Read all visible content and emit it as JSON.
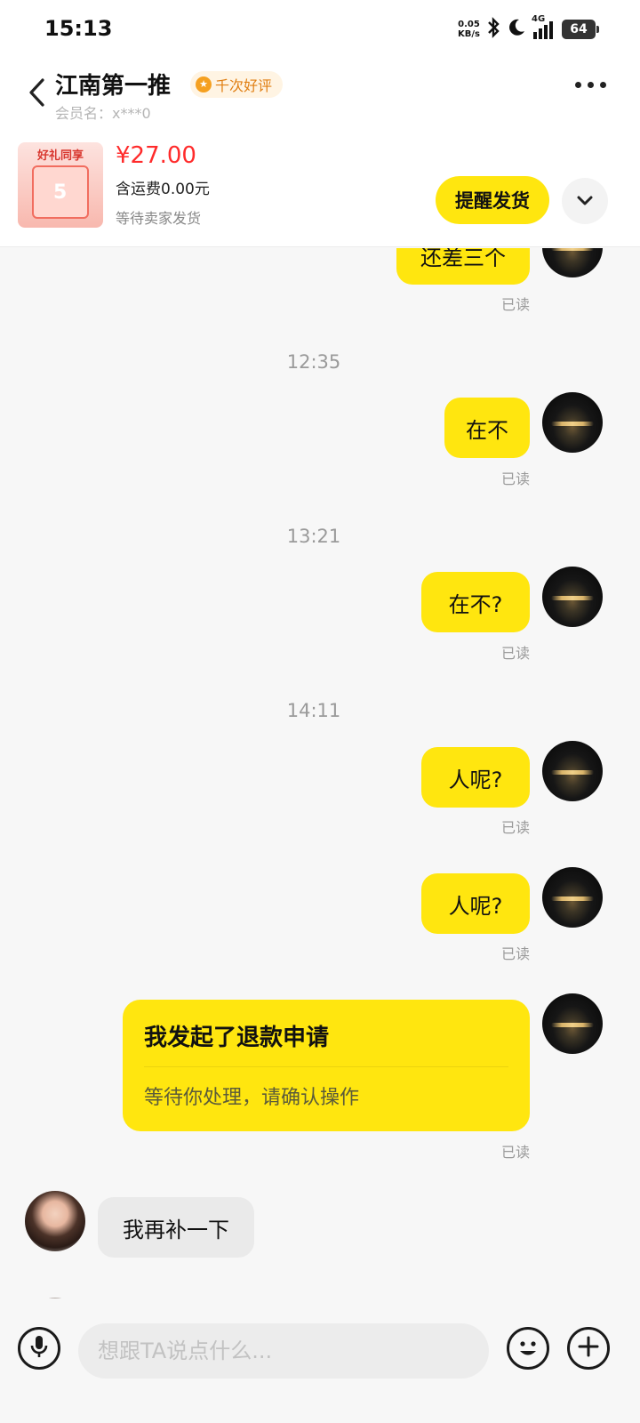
{
  "status_bar": {
    "time": "15:13",
    "net_speed_value": "0.05",
    "net_speed_unit": "KB/s",
    "network_type": "4G",
    "battery": "64"
  },
  "header": {
    "shop_name": "江南第一推",
    "rating_badge": "千次好评",
    "member_name": "会员名：x***0"
  },
  "order": {
    "thumb_title": "好礼同享",
    "thumb_number": "5",
    "price": "¥27.00",
    "shipping": "含运费0.00元",
    "status": "等待卖家发货",
    "remind_label": "提醒发货"
  },
  "messages": {
    "m1": "还差三个",
    "t1": "12:35",
    "m2": "在不",
    "t2": "13:21",
    "m3": "在不?",
    "t3": "14:11",
    "m4": "人呢?",
    "m5": "人呢?",
    "refund_title": "我发起了退款申请",
    "refund_sub": "等待你处理，请确认操作",
    "seller_msg": "我再补一下",
    "read_label": "已读"
  },
  "input": {
    "placeholder": "想跟TA说点什么..."
  },
  "colors": {
    "accent": "#ffe60f",
    "price": "#ff2b2b"
  }
}
